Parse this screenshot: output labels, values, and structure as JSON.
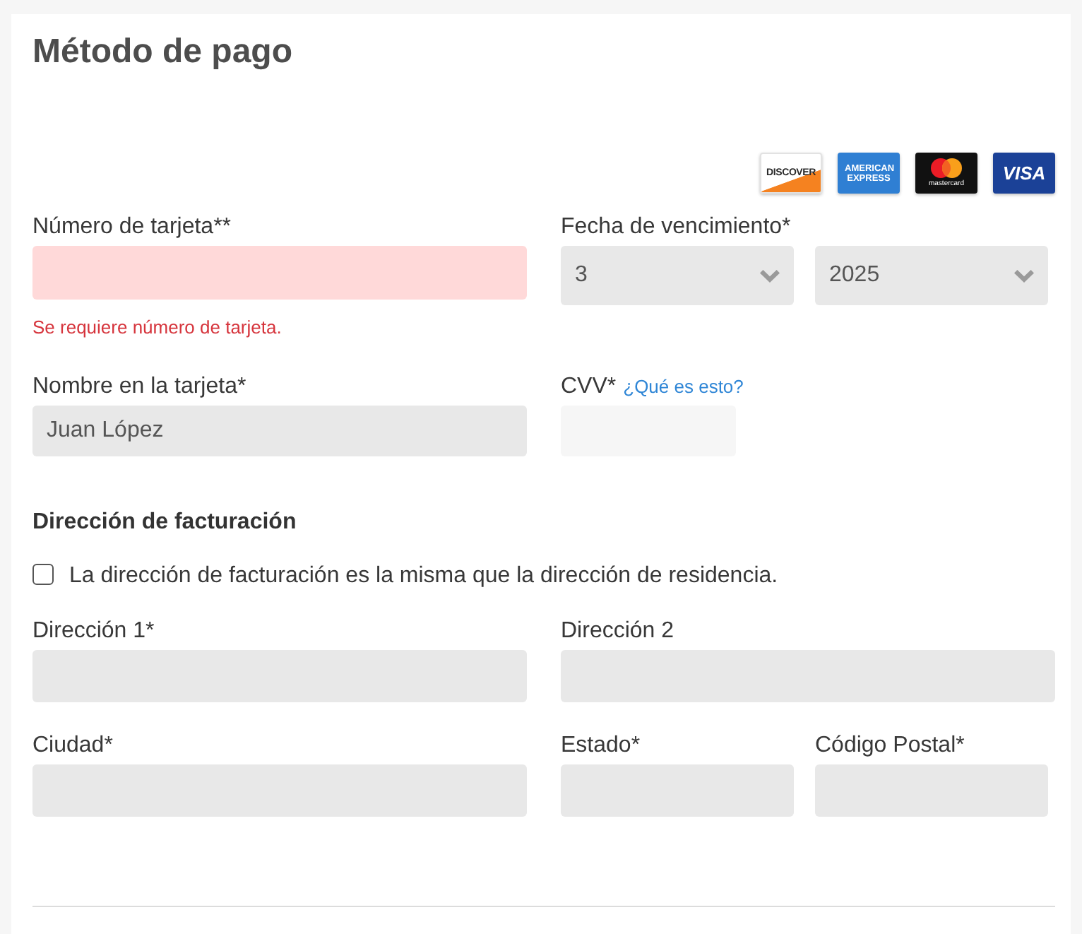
{
  "title": "Método de pago",
  "card_logos": [
    {
      "kind": "discover",
      "label": "DISCOVER"
    },
    {
      "kind": "amex",
      "label": "AMERICAN EXPRESS"
    },
    {
      "kind": "mastercard",
      "label": "mastercard"
    },
    {
      "kind": "visa",
      "label": "VISA"
    }
  ],
  "card": {
    "card_number": {
      "label": "Número de tarjeta**",
      "invalid": true,
      "error": "Se requiere número de tarjeta."
    },
    "expiry": {
      "label": "Fecha de vencimiento*",
      "month": "3",
      "year": "2025"
    },
    "name_on_card": {
      "label": "Nombre en la tarjeta*",
      "value": "Juan López"
    },
    "cvv": {
      "label": "CVV*",
      "help_link": "¿Qué es esto?"
    }
  },
  "billing": {
    "heading": "Dirección de facturación",
    "same_as_residence": {
      "label": "La dirección de facturación es la misma que la dirección de residencia.",
      "checked": false
    },
    "fields": [
      {
        "label": "Dirección 1*"
      },
      {
        "label": "Dirección 2"
      },
      {
        "label": "Ciudad*"
      },
      {
        "label": "Estado*"
      },
      {
        "label": "Código Postal*"
      }
    ]
  }
}
